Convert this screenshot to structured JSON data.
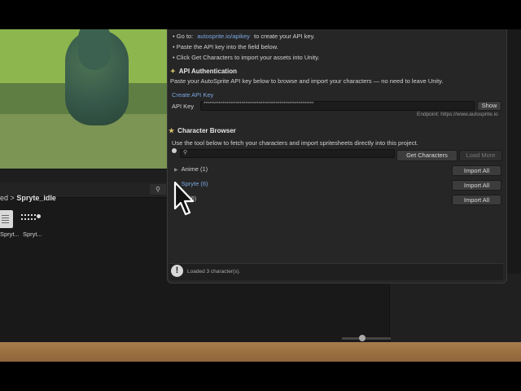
{
  "scene": {
    "project_search_icon": "search-icon"
  },
  "project": {
    "breadcrumb_parent": "ed",
    "breadcrumb_separator": ">",
    "breadcrumb_current": "Spryte_idle",
    "assets": [
      {
        "label": "Spryt...",
        "icon": "file-icon"
      },
      {
        "label": "Spryt...",
        "icon": "sprite-sheet-icon"
      }
    ]
  },
  "window": {
    "intro_lines": [
      {
        "bullet": "•",
        "prefix": "Go to:",
        "link": "autosprite.io/apikey",
        "suffix": "to create your API key."
      },
      {
        "bullet": "•",
        "text": "Paste the API key into the field below."
      },
      {
        "bullet": "•",
        "text": "Click Get Characters to import your assets into Unity."
      }
    ],
    "api_auth": {
      "title": "API Authentication",
      "description": "Paste your AutoSprite API key below to browse and import your characters — no need to leave Unity.",
      "create_link": "Create API Key",
      "field_label": "API Key",
      "field_value": "**********************************************************",
      "show_button": "Show",
      "endpoint": "Endpoint: https://www.autosprite.io"
    },
    "browser": {
      "title": "Character Browser",
      "description": "Use the tool below to fetch your characters and import spritesheets directly into this project.",
      "search_value": "",
      "get_button": "Get Characters",
      "load_more_button": "Load More",
      "groups": [
        {
          "label": "Anime (1)",
          "button": "Import All"
        },
        {
          "label": "Spryte (6)",
          "button": "Import All"
        },
        {
          "label": "(6)",
          "button": "Import All"
        }
      ]
    },
    "status": {
      "icon": "warning-icon",
      "text": "Loaded 3 character(s)."
    }
  },
  "colors": {
    "link": "#7aa7e0",
    "window_bg": "#262626",
    "editor_bg": "#191919",
    "heading_icon": "#d8c06a"
  }
}
